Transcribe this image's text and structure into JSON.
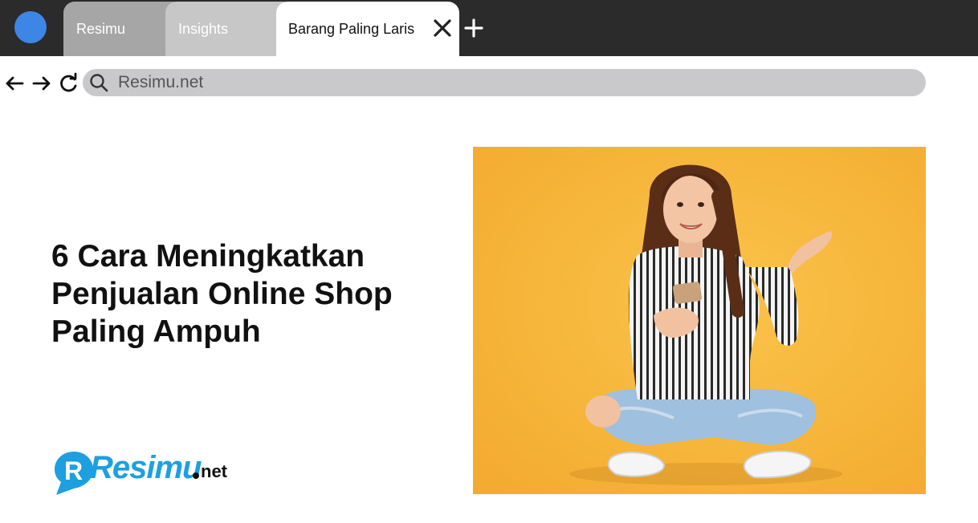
{
  "browser": {
    "tabs": [
      {
        "label": "Resimu"
      },
      {
        "label": "Insights"
      },
      {
        "label": "Barang Paling Laris"
      }
    ],
    "address": "Resimu.net"
  },
  "icons": {
    "profile": "profile-avatar",
    "close": "close-icon",
    "add": "plus-icon",
    "back": "arrow-left-icon",
    "forward": "arrow-right-icon",
    "reload": "reload-icon",
    "search": "search-icon"
  },
  "article": {
    "title": "6 Cara Meningkatkan Penjualan Online Shop Paling Ampuh",
    "image": "Smiling young woman sitting cross-legged holding a smartphone on a yellow-orange background"
  },
  "logo": {
    "name": "Resimu",
    "suffix": "net"
  },
  "colors": {
    "tabbar": "#2b2b2b",
    "profile": "#3d86e6",
    "addressbar": "#c9c9cb",
    "brand": "#1e9fe0",
    "photo_bg": "#f5b53a"
  }
}
